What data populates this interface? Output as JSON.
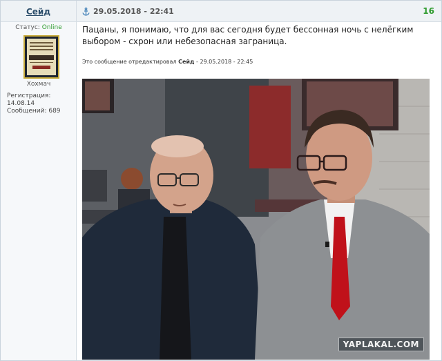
{
  "post": {
    "author": "Сейд",
    "datetime": "29.05.2018 - 22:41",
    "number": "16",
    "message": "Пацаны, я понимаю, что для вас сегодня будет бессонная ночь с нелёгким выбором - схрон или небезопасная заграница.",
    "edit_prefix": "Это сообщение отредактировал",
    "edit_user": "Сейд",
    "edit_datetime": "- 29.05.2018 - 22:45"
  },
  "user": {
    "status_label": "Статус:",
    "status_value": "Online",
    "rank": "Хохмач",
    "registration": "Регистрация: 14.08.14",
    "messages": "Сообщений: 689"
  },
  "image": {
    "watermark": "YAPLAKAL.COM"
  },
  "colors": {
    "online": "#2e9b2e",
    "post_number": "#2e9b2e",
    "author_link": "#2c4e6b"
  },
  "icons": {
    "anchor": "anchor-icon"
  }
}
